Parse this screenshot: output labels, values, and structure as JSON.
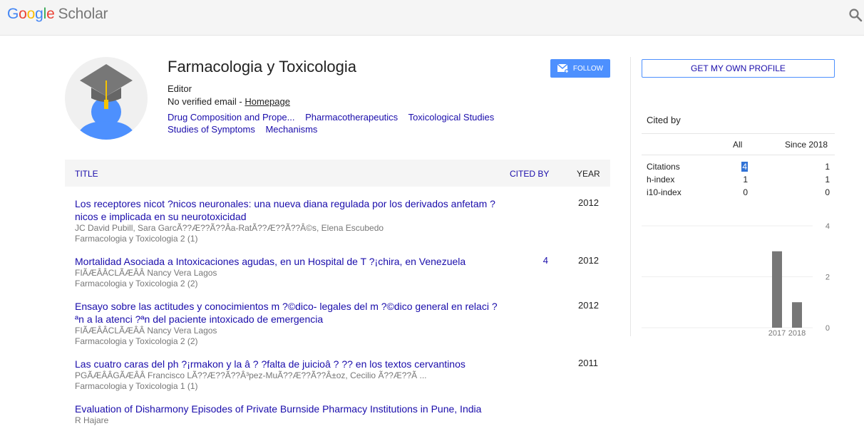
{
  "header": {
    "logo": {
      "g1": "G",
      "o1": "o",
      "o2": "o",
      "g2": "g",
      "l": "l",
      "e": "e",
      "product": "Scholar"
    },
    "search_icon": "search-icon"
  },
  "profile": {
    "name": "Farmacologia y Toxicologia",
    "affiliation": "Editor",
    "email_text": "No verified email - ",
    "homepage_label": "Homepage",
    "interests": [
      "Drug Composition and Prope...",
      "Pharmacotherapeutics",
      "Toxicological Studies",
      "Studies of Symptoms",
      "Mechanisms"
    ],
    "follow_label": "FOLLOW"
  },
  "table": {
    "col_title": "TITLE",
    "col_cited": "CITED BY",
    "col_year": "YEAR",
    "rows": [
      {
        "title": "Los receptores nicot ?nicos neuronales: una nueva diana regulada por los derivados anfetam ?nicos e implicada en su neurotoxicidad",
        "authors": "JC David Pubill, Sara GarcÃ??Æ??Ã??Âa-RatÃ??Æ??Ã??Â©s, Elena Escubedo",
        "venue": "Farmacologia y Toxicologia 2 (1)",
        "cited": "",
        "year": "2012"
      },
      {
        "title": "Mortalidad Asociada a Intoxicaciones agudas, en un Hospital de T ?¡chira, en Venezuela",
        "authors": "FIÃÆÂÂCLÃÆÂÂ Nancy Vera Lagos",
        "venue": "Farmacologia y Toxicologia 2 (2)",
        "cited": "4",
        "year": "2012"
      },
      {
        "title": "Ensayo sobre las actitudes y conocimientos m ?©dico- legales del m ?©dico general en relaci ?ªn a la atenci ?ªn del paciente intoxicado de emergencia",
        "authors": "FIÃÆÂÂCLÃÆÂÂ Nancy Vera Lagos",
        "venue": "Farmacologia y Toxicologia 2 (2)",
        "cited": "",
        "year": "2012"
      },
      {
        "title": "Las cuatro caras del ph ?¡rmakon y la â ? ?falta de juicioâ ? ?? en los textos cervantinos",
        "authors": "PGÃÆÂÂGÃÆÂÂ Francisco LÃ??Æ??Ã??Â³pez-MuÃ??Æ??Ã??Â±oz, Cecilio Ã??Æ??Ã ...",
        "venue": "Farmacologia y Toxicologia 1 (1)",
        "cited": "",
        "year": "2011"
      },
      {
        "title": "Evaluation of Disharmony Episodes of Private Burnside Pharmacy Institutions in Pune, India",
        "authors": "R Hajare",
        "venue": "",
        "cited": "",
        "year": ""
      }
    ]
  },
  "sidebar": {
    "get_profile_label": "GET MY OWN PROFILE",
    "cited_by_title": "Cited by",
    "col_all": "All",
    "col_since": "Since 2018",
    "metrics": [
      {
        "label": "Citations",
        "all": "4",
        "since": "1"
      },
      {
        "label": "h-index",
        "all": "1",
        "since": "1"
      },
      {
        "label": "i10-index",
        "all": "0",
        "since": "0"
      }
    ]
  },
  "chart_data": {
    "type": "bar",
    "categories": [
      "2017",
      "2018"
    ],
    "values": [
      3,
      1
    ],
    "ylim": [
      0,
      4
    ],
    "yticks": [
      "4",
      "2",
      "0"
    ],
    "color": "#777777"
  }
}
